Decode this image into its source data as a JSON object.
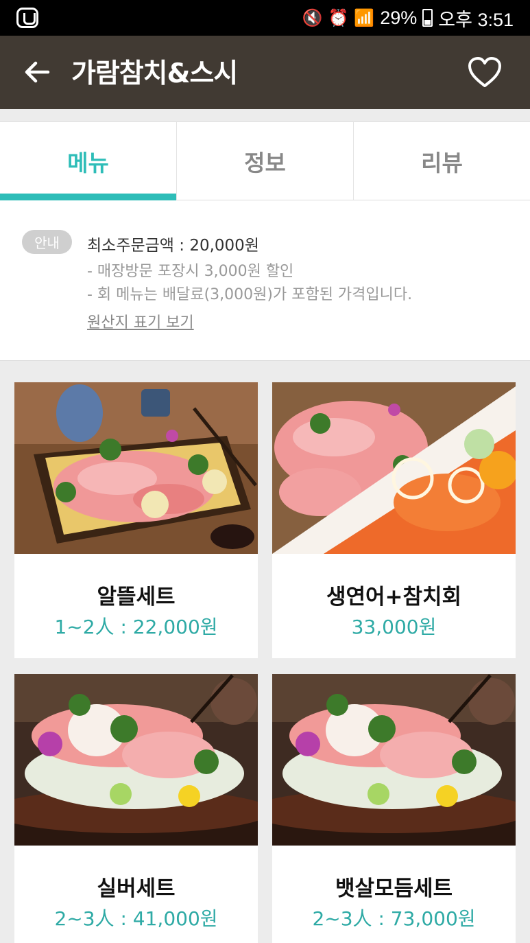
{
  "status_bar": {
    "battery": "29%",
    "time": "오후 3:51"
  },
  "app_bar": {
    "title": "가람참치&스시"
  },
  "tabs": [
    {
      "label": "메뉴",
      "active": true
    },
    {
      "label": "정보",
      "active": false
    },
    {
      "label": "리뷰",
      "active": false
    }
  ],
  "notice": {
    "badge": "안내",
    "min_order": "최소주문금액 : 20,000원",
    "lines": [
      "- 매장방문 포장시 3,000원 할인",
      "- 회 메뉴는 배달료(3,000원)가 포함된 가격입니다."
    ],
    "origin_link": "원산지 표기 보기"
  },
  "menu": [
    {
      "name": "알뜰세트",
      "price": "1~2人 : 22,000원"
    },
    {
      "name": "생연어+참치회",
      "price": "33,000원"
    },
    {
      "name": "실버세트",
      "price": "2~3人 : 41,000원"
    },
    {
      "name": "뱃살모듬세트",
      "price": "2~3人 : 73,000원"
    }
  ],
  "colors": {
    "accent": "#2ebdb8",
    "app_bar": "#413a33"
  }
}
